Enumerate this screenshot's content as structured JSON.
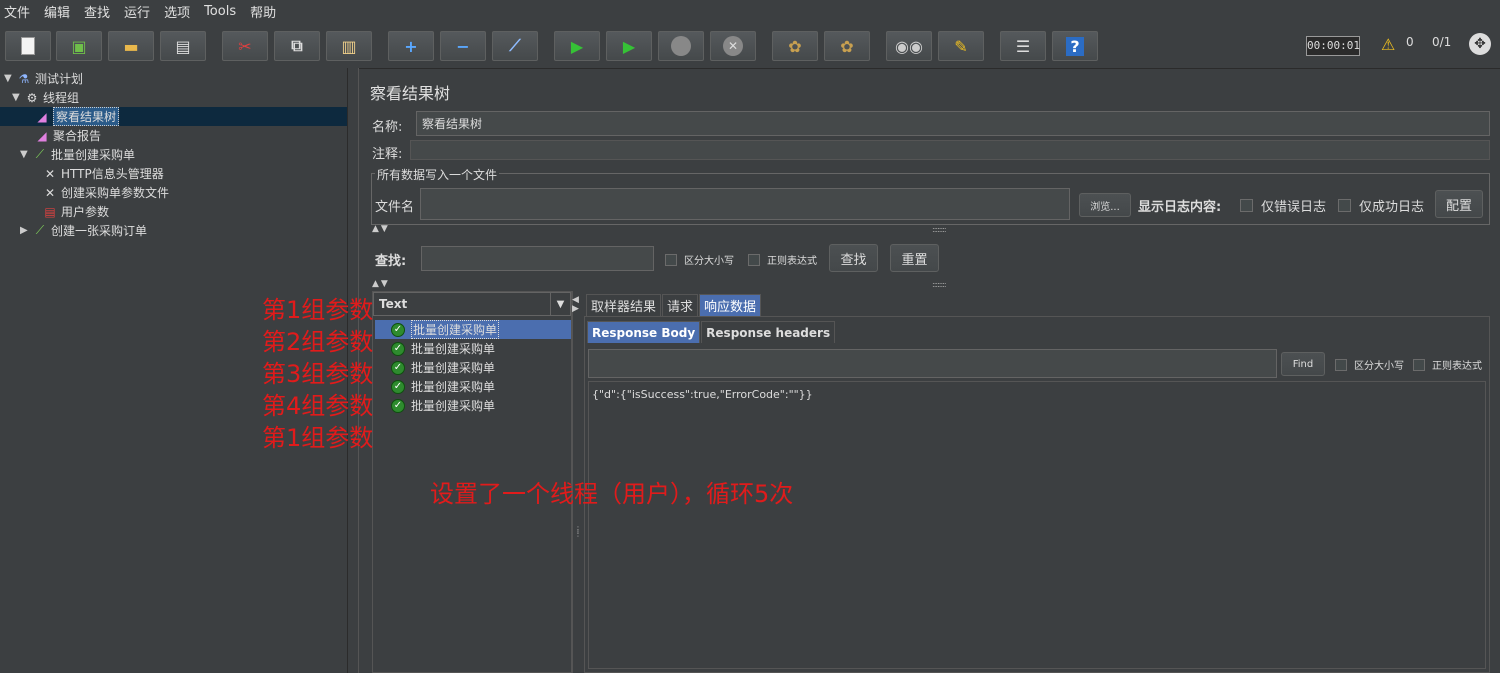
{
  "menu": [
    "文件",
    "编辑",
    "查找",
    "运行",
    "选项",
    "Tools",
    "帮助"
  ],
  "toolbar": {
    "timer": "00:00:01",
    "warning_count": "0",
    "threads": "0/1"
  },
  "tree": {
    "items": [
      {
        "label": "测试计划",
        "icon": "flask-icon"
      },
      {
        "label": "线程组",
        "icon": "gear-icon"
      },
      {
        "label": "察看结果树",
        "icon": "graph-icon"
      },
      {
        "label": "聚合报告",
        "icon": "graph-icon"
      },
      {
        "label": "批量创建采购单",
        "icon": "sampler-icon"
      },
      {
        "label": "HTTP信息头管理器",
        "icon": "tools-icon"
      },
      {
        "label": "创建采购单参数文件",
        "icon": "tools-icon"
      },
      {
        "label": "用户参数",
        "icon": "params-icon"
      },
      {
        "label": "创建一张采购订单",
        "icon": "sampler-icon"
      }
    ]
  },
  "panel": {
    "title": "察看结果树",
    "name_label": "名称:",
    "name_value": "察看结果树",
    "comment_label": "注释:",
    "file_group_legend": "所有数据写入一个文件",
    "filename_label": "文件名",
    "browse": "浏览...",
    "log_label": "显示日志内容:",
    "errors_only": "仅错误日志",
    "success_only": "仅成功日志",
    "configure": "配置",
    "search_label": "查找:",
    "case_sensitive": "区分大小写",
    "regex": "正则表达式",
    "search_button": "查找",
    "reset_button": "重置"
  },
  "results": {
    "renderer": "Text",
    "items": [
      "批量创建采购单",
      "批量创建采购单",
      "批量创建采购单",
      "批量创建采购单",
      "批量创建采购单"
    ]
  },
  "tabs": [
    "取样器结果",
    "请求",
    "响应数据"
  ],
  "subtabs": [
    "Response Body",
    "Response headers"
  ],
  "response": {
    "find_button": "Find",
    "case_sensitive": "区分大小写",
    "regex": "正则表达式",
    "body": "{\"d\":{\"isSuccess\":true,\"ErrorCode\":\"\"}}"
  },
  "annotations": {
    "groups": [
      "第1组参数",
      "第2组参数",
      "第3组参数",
      "第4组参数",
      "第1组参数"
    ],
    "note": "设置了一个线程（用户），循环5次"
  },
  "colors": {
    "selection": "#4b6eaf",
    "tree_selection": "#0d293e",
    "annotation": "#e11b1b"
  }
}
